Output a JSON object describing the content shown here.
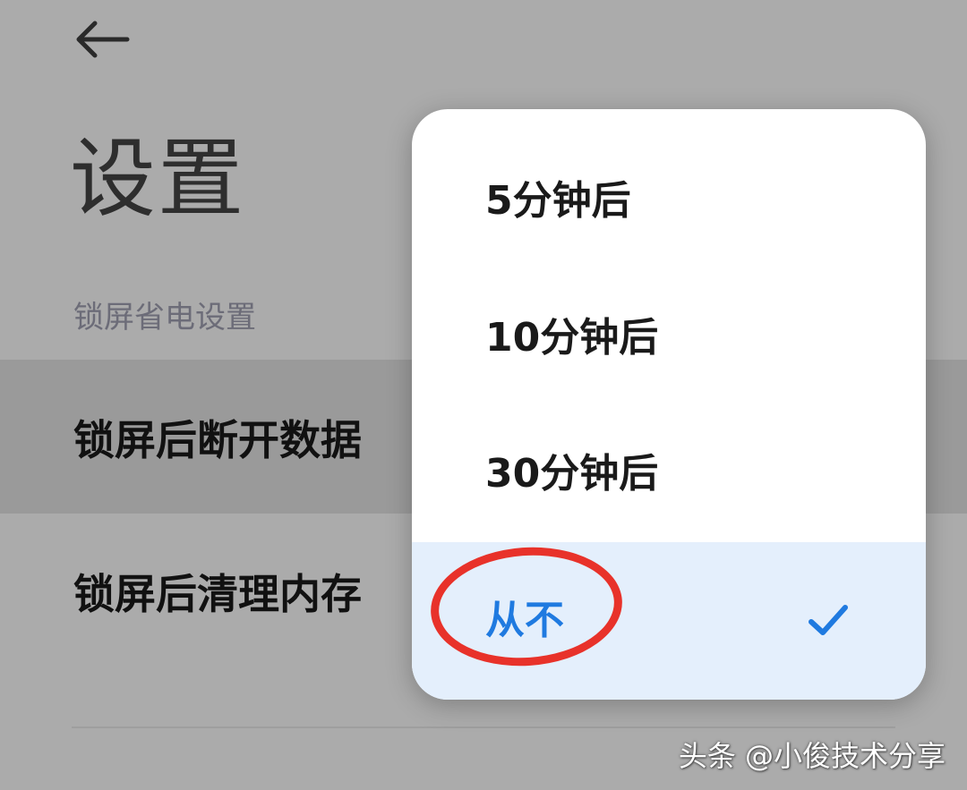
{
  "header": {
    "back_icon": "arrow-left-icon",
    "title": "设置"
  },
  "section": {
    "header": "锁屏省电设置"
  },
  "settings": [
    {
      "label": "锁屏后断开数据"
    },
    {
      "label": "锁屏后清理内存"
    }
  ],
  "popup": {
    "options": [
      {
        "label": "5分钟后",
        "selected": false
      },
      {
        "label": "10分钟后",
        "selected": false
      },
      {
        "label": "30分钟后",
        "selected": false
      },
      {
        "label": "从不",
        "selected": true
      }
    ],
    "selected_icon": "checkmark-icon"
  },
  "watermark": "头条 @小俊技术分享",
  "colors": {
    "overlay_background": "#ababab",
    "highlight_row": "#9a9a9a",
    "accent": "#1f7ae0",
    "selected_bg": "#e4effc",
    "annotation": "#e8322a"
  }
}
